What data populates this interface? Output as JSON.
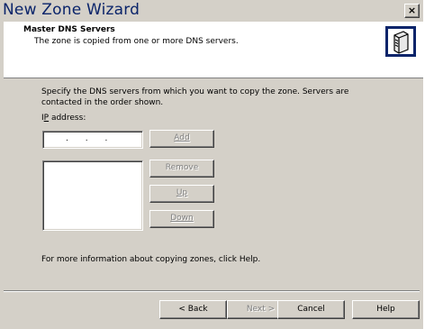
{
  "window": {
    "title": "New Zone Wizard",
    "close_label": "×"
  },
  "header": {
    "title": "Master DNS Servers",
    "subtitle": "The zone is copied from one or more DNS servers.",
    "icon": "server-icon"
  },
  "content": {
    "instructions": "Specify the DNS servers from which you want to copy the zone. Servers are contacted in the order shown.",
    "ip_label_prefix": "I",
    "ip_label_accel": "P",
    "ip_label_rest": " address:",
    "ip_value": ". . .",
    "buttons": {
      "add": "Add",
      "remove": "Remove",
      "up": "Up",
      "down": "Down"
    },
    "info_text": "For more information about copying zones, click Help."
  },
  "footer": {
    "back": "< Back",
    "next": "Next >",
    "cancel": "Cancel",
    "help": "Help"
  }
}
